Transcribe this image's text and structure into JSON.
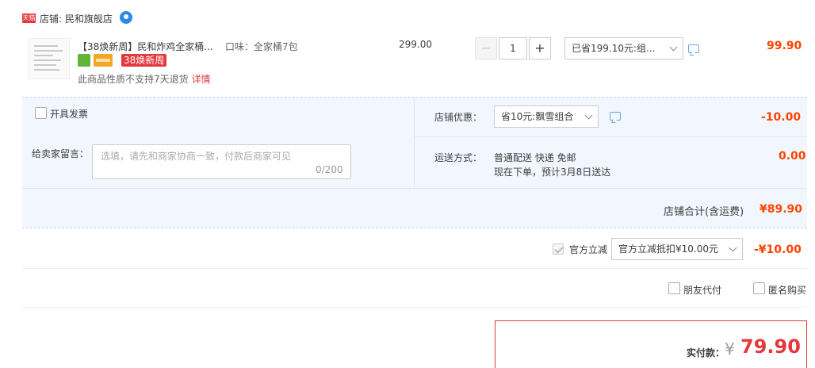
{
  "shop": {
    "badge": "天猫",
    "name": "店铺: 民和旗舰店"
  },
  "item": {
    "title": "【38焕新周】民和炸鸡全家桶...",
    "sku": "口味：全家桶7包",
    "tag": "38焕新周",
    "note": "此商品性质不支持7天退货",
    "note_link": "详情",
    "unit_price": "299.00",
    "quantity": "1",
    "saving_select": "已省199.10元:组...",
    "total": "99.90"
  },
  "invoice": {
    "label": "开具发票"
  },
  "message": {
    "label": "给卖家留言：",
    "placeholder": "选填，请先和商家协商一致，付款后商家可见",
    "count": "0/200"
  },
  "shop_discount": {
    "label": "店铺优惠：",
    "select": "省10元:飘雪组合",
    "value": "-10.00"
  },
  "shipping": {
    "label": "运送方式：",
    "line1": "普通配送 快递 免邮",
    "line2": "现在下单，预计3月8日送达",
    "value": "0.00"
  },
  "shop_total": {
    "label": "店铺合计(含运费)",
    "value": "¥89.90"
  },
  "official": {
    "label": "官方立减",
    "select": "官方立减抵扣¥10.00元",
    "value": "-¥10.00"
  },
  "options": {
    "friend_pay": "朋友代付",
    "anonymous": "匿名购买"
  },
  "payment": {
    "label": "实付款：",
    "currency": "¥",
    "value": "79.90"
  },
  "colors": {
    "accent": "#e4393c",
    "price": "#ff4400",
    "panel": "#f2f7ff"
  }
}
